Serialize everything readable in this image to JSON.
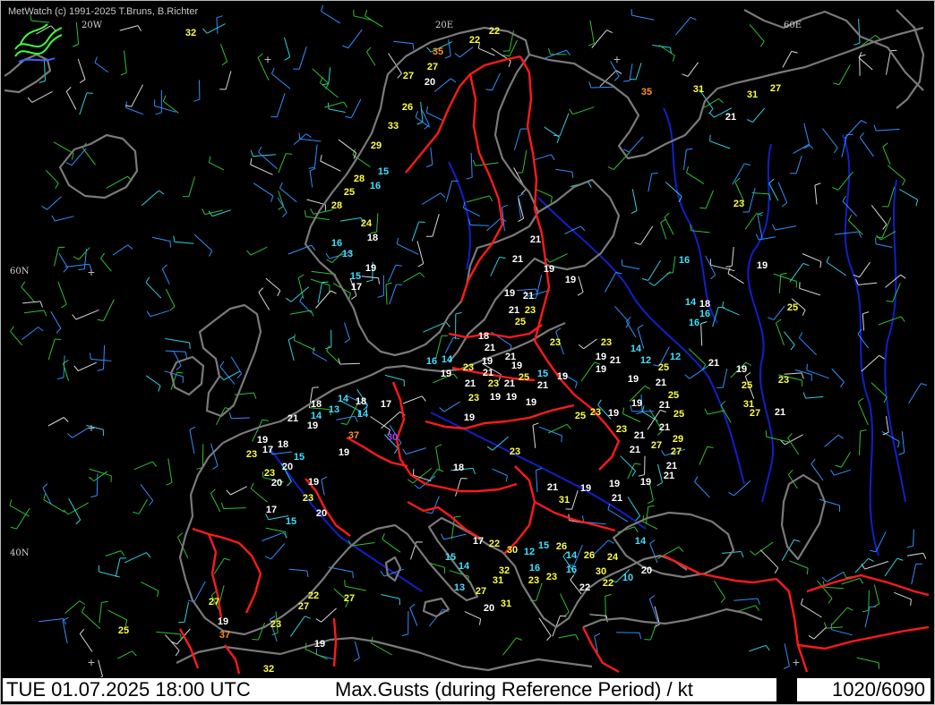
{
  "header": {
    "credit": "MetWatch  (c) 1991-2025 T.Bruns, B.Richter"
  },
  "status_bar": {
    "datetime": "TUE 01.07.2025 18:00 UTC",
    "title": "Max.Gusts (during Reference Period) / kt",
    "station_count": "1020/6090"
  },
  "grid_labels": {
    "lon_20w": "20W",
    "lon_20e": "20E",
    "lon_60e": "60E",
    "lat_60n": "60N",
    "lat_40n": "40N"
  },
  "colors": {
    "background": "#000000",
    "coast": "#7a7a7a",
    "border": "#ff1010",
    "river": "#1020c8",
    "gust_high": "#ffff40",
    "gust_mid": "#ffffff",
    "gust_low": "#40e0ff",
    "gust_extreme": "#ff9020",
    "gust_special": "#b040ff"
  },
  "icons": {
    "logo": "metwatch-wave-logo-icon",
    "grid": "plus-cross-icon"
  },
  "stations": [
    [
      212,
      36,
      "32",
      "y"
    ],
    [
      529,
      44,
      "22",
      "y"
    ],
    [
      551,
      34,
      "22",
      "y"
    ],
    [
      488,
      57,
      "35",
      "o"
    ],
    [
      482,
      74,
      "27",
      "y"
    ],
    [
      455,
      84,
      "27",
      "y"
    ],
    [
      479,
      91,
      "20",
      "w"
    ],
    [
      721,
      102,
      "35",
      "o"
    ],
    [
      779,
      99,
      "31",
      "y"
    ],
    [
      839,
      105,
      "31",
      "y"
    ],
    [
      865,
      98,
      "27",
      "y"
    ],
    [
      815,
      130,
      "21",
      "w"
    ],
    [
      454,
      119,
      "26",
      "y"
    ],
    [
      438,
      140,
      "33",
      "y"
    ],
    [
      419,
      162,
      "29",
      "y"
    ],
    [
      427,
      191,
      "15",
      "c"
    ],
    [
      400,
      199,
      "28",
      "y"
    ],
    [
      418,
      207,
      "16",
      "c"
    ],
    [
      389,
      214,
      "25",
      "y"
    ],
    [
      375,
      229,
      "28",
      "y"
    ],
    [
      824,
      227,
      "23",
      "y"
    ],
    [
      408,
      249,
      "24",
      "y"
    ],
    [
      415,
      265,
      "18",
      "w"
    ],
    [
      375,
      271,
      "16",
      "c"
    ],
    [
      597,
      267,
      "21",
      "w"
    ],
    [
      387,
      283,
      "13",
      "c"
    ],
    [
      577,
      289,
      "21",
      "w"
    ],
    [
      763,
      290,
      "16",
      "c"
    ],
    [
      850,
      296,
      "19",
      "w"
    ],
    [
      413,
      299,
      "19",
      "w"
    ],
    [
      612,
      300,
      "19",
      "w"
    ],
    [
      636,
      312,
      "19",
      "w"
    ],
    [
      396,
      308,
      "15",
      "c"
    ],
    [
      397,
      320,
      "17",
      "w"
    ],
    [
      568,
      327,
      "19",
      "w"
    ],
    [
      589,
      330,
      "21",
      "w"
    ],
    [
      770,
      337,
      "14",
      "c"
    ],
    [
      786,
      339,
      "18",
      "w"
    ],
    [
      573,
      346,
      "21",
      "w"
    ],
    [
      591,
      346,
      "23",
      "y"
    ],
    [
      786,
      350,
      "16",
      "c"
    ],
    [
      884,
      343,
      "25",
      "y"
    ],
    [
      580,
      359,
      "25",
      "y"
    ],
    [
      774,
      360,
      "16",
      "c"
    ],
    [
      539,
      375,
      "18",
      "w"
    ],
    [
      546,
      388,
      "21",
      "w"
    ],
    [
      619,
      382,
      "23",
      "y"
    ],
    [
      676,
      382,
      "23",
      "y"
    ],
    [
      709,
      389,
      "14",
      "c"
    ],
    [
      569,
      398,
      "21",
      "w"
    ],
    [
      670,
      398,
      "19",
      "w"
    ],
    [
      686,
      402,
      "21",
      "w"
    ],
    [
      720,
      402,
      "12",
      "c"
    ],
    [
      753,
      398,
      "12",
      "c"
    ],
    [
      740,
      410,
      "25",
      "y"
    ],
    [
      796,
      405,
      "21",
      "w"
    ],
    [
      481,
      403,
      "16",
      "c"
    ],
    [
      498,
      401,
      "14",
      "c"
    ],
    [
      522,
      410,
      "23",
      "y"
    ],
    [
      543,
      403,
      "19",
      "w"
    ],
    [
      576,
      408,
      "19",
      "w"
    ],
    [
      670,
      412,
      "19",
      "w"
    ],
    [
      827,
      412,
      "19",
      "w"
    ],
    [
      497,
      417,
      "19",
      "w"
    ],
    [
      544,
      416,
      "21",
      "w"
    ],
    [
      584,
      421,
      "25",
      "y"
    ],
    [
      605,
      417,
      "15",
      "c"
    ],
    [
      627,
      420,
      "19",
      "w"
    ],
    [
      706,
      423,
      "19",
      "w"
    ],
    [
      874,
      424,
      "23",
      "y"
    ],
    [
      524,
      428,
      "21",
      "w"
    ],
    [
      550,
      428,
      "23",
      "y"
    ],
    [
      568,
      428,
      "21",
      "w"
    ],
    [
      605,
      430,
      "21",
      "w"
    ],
    [
      737,
      427,
      "21",
      "w"
    ],
    [
      833,
      430,
      "25",
      "y"
    ],
    [
      382,
      445,
      "14",
      "c"
    ],
    [
      402,
      448,
      "18",
      "w"
    ],
    [
      430,
      451,
      "17",
      "w"
    ],
    [
      352,
      451,
      "18",
      "w"
    ],
    [
      528,
      444,
      "23",
      "y"
    ],
    [
      552,
      443,
      "19",
      "w"
    ],
    [
      570,
      443,
      "19",
      "w"
    ],
    [
      592,
      449,
      "19",
      "w"
    ],
    [
      751,
      441,
      "25",
      "y"
    ],
    [
      710,
      450,
      "19",
      "w"
    ],
    [
      741,
      452,
      "21",
      "w"
    ],
    [
      835,
      451,
      "31",
      "y"
    ],
    [
      352,
      464,
      "14",
      "c"
    ],
    [
      372,
      457,
      "13",
      "c"
    ],
    [
      404,
      462,
      "14",
      "c"
    ],
    [
      326,
      467,
      "21",
      "w"
    ],
    [
      523,
      466,
      "19",
      "w"
    ],
    [
      647,
      464,
      "25",
      "y"
    ],
    [
      664,
      460,
      "23",
      "y"
    ],
    [
      684,
      461,
      "19",
      "w"
    ],
    [
      757,
      462,
      "25",
      "y"
    ],
    [
      842,
      461,
      "27",
      "y"
    ],
    [
      870,
      460,
      "21",
      "w"
    ],
    [
      348,
      475,
      "19",
      "w"
    ],
    [
      693,
      479,
      "23",
      "y"
    ],
    [
      741,
      477,
      "21",
      "w"
    ],
    [
      713,
      486,
      "21",
      "w"
    ],
    [
      394,
      486,
      "37",
      "o"
    ],
    [
      437,
      488,
      "30",
      "p"
    ],
    [
      756,
      490,
      "29",
      "y"
    ],
    [
      292,
      491,
      "19",
      "w"
    ],
    [
      298,
      502,
      "17",
      "w"
    ],
    [
      315,
      496,
      "18",
      "w"
    ],
    [
      732,
      497,
      "27",
      "y"
    ],
    [
      708,
      502,
      "21",
      "w"
    ],
    [
      280,
      507,
      "23",
      "y"
    ],
    [
      383,
      505,
      "19",
      "w"
    ],
    [
      333,
      510,
      "15",
      "c"
    ],
    [
      574,
      504,
      "23",
      "y"
    ],
    [
      754,
      504,
      "27",
      "y"
    ],
    [
      320,
      521,
      "20",
      "w"
    ],
    [
      511,
      522,
      "18",
      "w"
    ],
    [
      749,
      520,
      "21",
      "w"
    ],
    [
      300,
      528,
      "23",
      "y"
    ],
    [
      308,
      539,
      "20",
      "w"
    ],
    [
      349,
      538,
      "19",
      "w"
    ],
    [
      746,
      531,
      "21",
      "w"
    ],
    [
      616,
      544,
      "21",
      "w"
    ],
    [
      653,
      545,
      "19",
      "w"
    ],
    [
      685,
      540,
      "19",
      "w"
    ],
    [
      720,
      538,
      "19",
      "w"
    ],
    [
      343,
      556,
      "23",
      "y"
    ],
    [
      629,
      558,
      "31",
      "y"
    ],
    [
      688,
      556,
      "21",
      "w"
    ],
    [
      302,
      569,
      "17",
      "w"
    ],
    [
      358,
      573,
      "20",
      "w"
    ],
    [
      324,
      582,
      "15",
      "c"
    ],
    [
      533,
      604,
      "17",
      "w"
    ],
    [
      551,
      607,
      "22",
      "y"
    ],
    [
      571,
      614,
      "30",
      "y"
    ],
    [
      590,
      616,
      "12",
      "c"
    ],
    [
      606,
      609,
      "15",
      "c"
    ],
    [
      626,
      610,
      "26",
      "y"
    ],
    [
      714,
      604,
      "14",
      "c"
    ],
    [
      637,
      620,
      "14",
      "c"
    ],
    [
      657,
      620,
      "26",
      "y"
    ],
    [
      683,
      622,
      "24",
      "y"
    ],
    [
      502,
      622,
      "15",
      "c"
    ],
    [
      517,
      632,
      "14",
      "c"
    ],
    [
      562,
      637,
      "32",
      "y"
    ],
    [
      596,
      634,
      "16",
      "c"
    ],
    [
      637,
      636,
      "16",
      "c"
    ],
    [
      670,
      638,
      "30",
      "y"
    ],
    [
      721,
      637,
      "20",
      "w"
    ],
    [
      595,
      648,
      "23",
      "y"
    ],
    [
      615,
      644,
      "23",
      "y"
    ],
    [
      555,
      648,
      "31",
      "y"
    ],
    [
      700,
      645,
      "10",
      "c"
    ],
    [
      678,
      651,
      "22",
      "y"
    ],
    [
      652,
      656,
      "22",
      "w"
    ],
    [
      512,
      656,
      "13",
      "c"
    ],
    [
      536,
      660,
      "27",
      "y"
    ],
    [
      349,
      665,
      "22",
      "y"
    ],
    [
      389,
      668,
      "27",
      "y"
    ],
    [
      338,
      677,
      "27",
      "y"
    ],
    [
      238,
      672,
      "27",
      "y"
    ],
    [
      564,
      674,
      "31",
      "y"
    ],
    [
      545,
      679,
      "20",
      "w"
    ],
    [
      248,
      694,
      "19",
      "w"
    ],
    [
      307,
      697,
      "23",
      "y"
    ],
    [
      137,
      704,
      "25",
      "y"
    ],
    [
      250,
      709,
      "37",
      "o"
    ],
    [
      356,
      719,
      "19",
      "w"
    ],
    [
      299,
      747,
      "32",
      "y"
    ]
  ]
}
